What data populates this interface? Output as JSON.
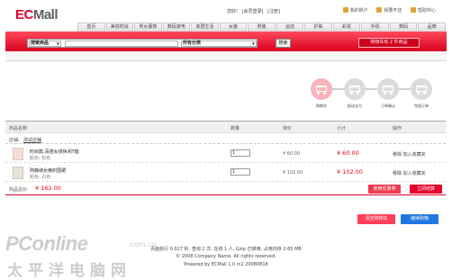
{
  "brand": {
    "ec": "EC",
    "mall": "Mall"
  },
  "header": {
    "greeting": "您好!",
    "login": "[会员登录]",
    "register": "[注册]",
    "my_account": "我的账户",
    "open_store": "我要开店",
    "help": "帮助中心"
  },
  "nav": [
    "首页",
    "美容时尚",
    "男女服饰",
    "数码家电",
    "家居生活",
    "女装",
    "男装",
    "运动",
    "护肤",
    "彩妆",
    "手机",
    "数码",
    "品牌"
  ],
  "search": {
    "type_select": "搜索商品",
    "category_select": "所有分类",
    "button": "搜索"
  },
  "cart_link": "购物车有 2 件商品",
  "steps": [
    "购物车",
    "配送支付",
    "订单确认",
    "完成订单"
  ],
  "table": {
    "headers": {
      "name": "商品名称",
      "qty": "数量",
      "price": "单价",
      "subtotal": "小计",
      "ops": "操作"
    },
    "store_label": "店铺:",
    "store_name": "测试店铺",
    "rows": [
      {
        "name": "时尚款,百搭女孩休闲T恤",
        "color": "颜色: 粉色",
        "qty": "1",
        "price": "¥ 60.00",
        "subtotal": "¥ 60.00",
        "actions": "移除  加入收藏夹"
      },
      {
        "name": "阿森纳女棱织围裙",
        "color": "颜色: 白色",
        "qty": "1",
        "price": "¥ 102.00",
        "subtotal": "¥ 102.00",
        "actions": "移除  加入收藏夹"
      }
    ],
    "total_label": "商品总价:",
    "total_value": "¥ 162.00",
    "coupon_button": "使用优惠券",
    "checkout_button": "立即结算"
  },
  "buttons": {
    "clear": "清空购物车",
    "continue": "继续购物"
  },
  "footer": {
    "line1": "页面执行 0.027 秒, 查询 2 次, 在线 1 人, Gzip 已禁用, 占用内存 2.65 MB",
    "line2": "© 2008 Company Name. All rights reserved.",
    "line3": "Powered by ECMall 1.0 rc2 20080818"
  },
  "watermark": {
    "line1": "PConline",
    "domain": ".com.cn",
    "line2": "太平洋电脑网"
  }
}
